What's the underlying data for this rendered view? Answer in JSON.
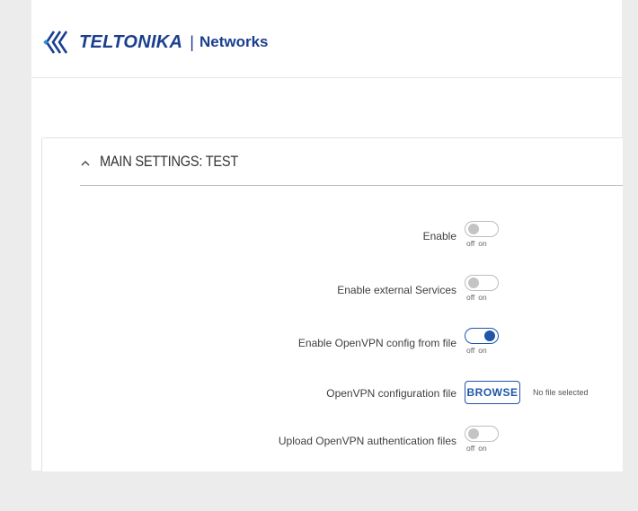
{
  "brand": {
    "name": "TELTONIKA",
    "separator": "|",
    "product": "Networks"
  },
  "section": {
    "title": "MAIN SETTINGS: TEST",
    "expanded": true
  },
  "settings": [
    {
      "label": "Enable",
      "type": "toggle",
      "value": false,
      "off": "off",
      "on": "on"
    },
    {
      "label": "Enable external Services",
      "type": "toggle",
      "value": false,
      "off": "off",
      "on": "on"
    },
    {
      "label": "Enable OpenVPN config from file",
      "type": "toggle",
      "value": true,
      "off": "off",
      "on": "on"
    },
    {
      "label": "OpenVPN configuration file",
      "type": "file",
      "button": "BROWSE",
      "status": "No file selected"
    },
    {
      "label": "Upload OpenVPN authentication files",
      "type": "toggle",
      "value": false,
      "off": "off",
      "on": "on"
    }
  ],
  "colors": {
    "accent": "#1f56a8",
    "brand": "#1a3f8f",
    "background": "#ececec"
  }
}
